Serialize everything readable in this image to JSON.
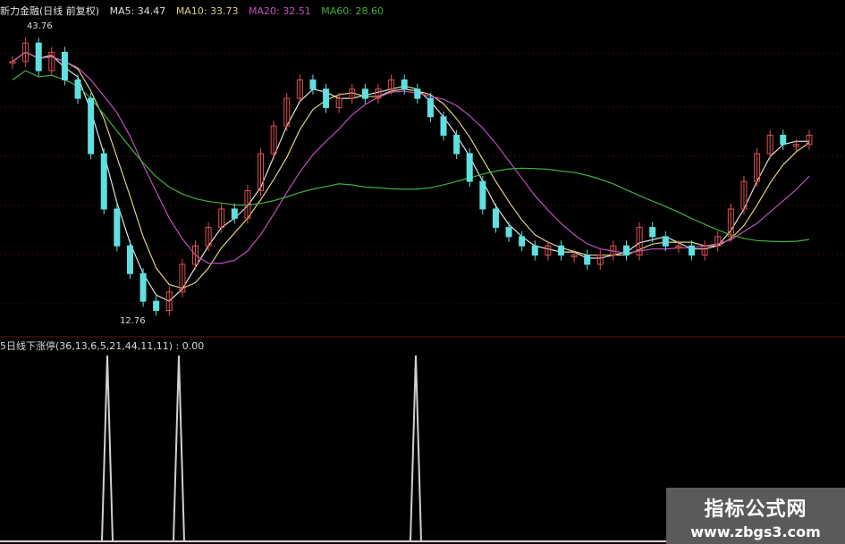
{
  "header": {
    "stock_name": "新力金融(日线 前复权)",
    "ma5": "MA5: 34.47",
    "ma10": "MA10: 33.73",
    "ma20": "MA20: 32.51",
    "ma60": "MA60: 28.60"
  },
  "colors": {
    "up": "#e05050",
    "down": "#60e0e0",
    "ma5": "#e0e0e0",
    "ma10": "#e0d080",
    "ma20": "#c050c0",
    "ma60": "#40b040",
    "grid": "#3a0a0a",
    "indicator": "#d0d0d0"
  },
  "price_labels": {
    "high": "43.76",
    "low": "12.76"
  },
  "indicator": {
    "title": "5日线下涨停(36,13,6,5,21,44,11,11) : 0.00"
  },
  "watermark": {
    "line1": "指标公式网",
    "line2": "www.zbgs3.com"
  },
  "chart_data": {
    "type": "candlestick",
    "price_range": [
      12.76,
      43.76
    ],
    "close_path": [
      40,
      42,
      39,
      41,
      38,
      36,
      30,
      24,
      20,
      17,
      14,
      13,
      15,
      18,
      20,
      22,
      24,
      23,
      26,
      30,
      33,
      36,
      38,
      37,
      35,
      36,
      37,
      36,
      37,
      38,
      37,
      36,
      34,
      32,
      30,
      27,
      24,
      22,
      21,
      20,
      19,
      20,
      19,
      19,
      18,
      19,
      20,
      19,
      22,
      21,
      20,
      20,
      19,
      20,
      21,
      24,
      27,
      30,
      32,
      31,
      31,
      32
    ]
  }
}
